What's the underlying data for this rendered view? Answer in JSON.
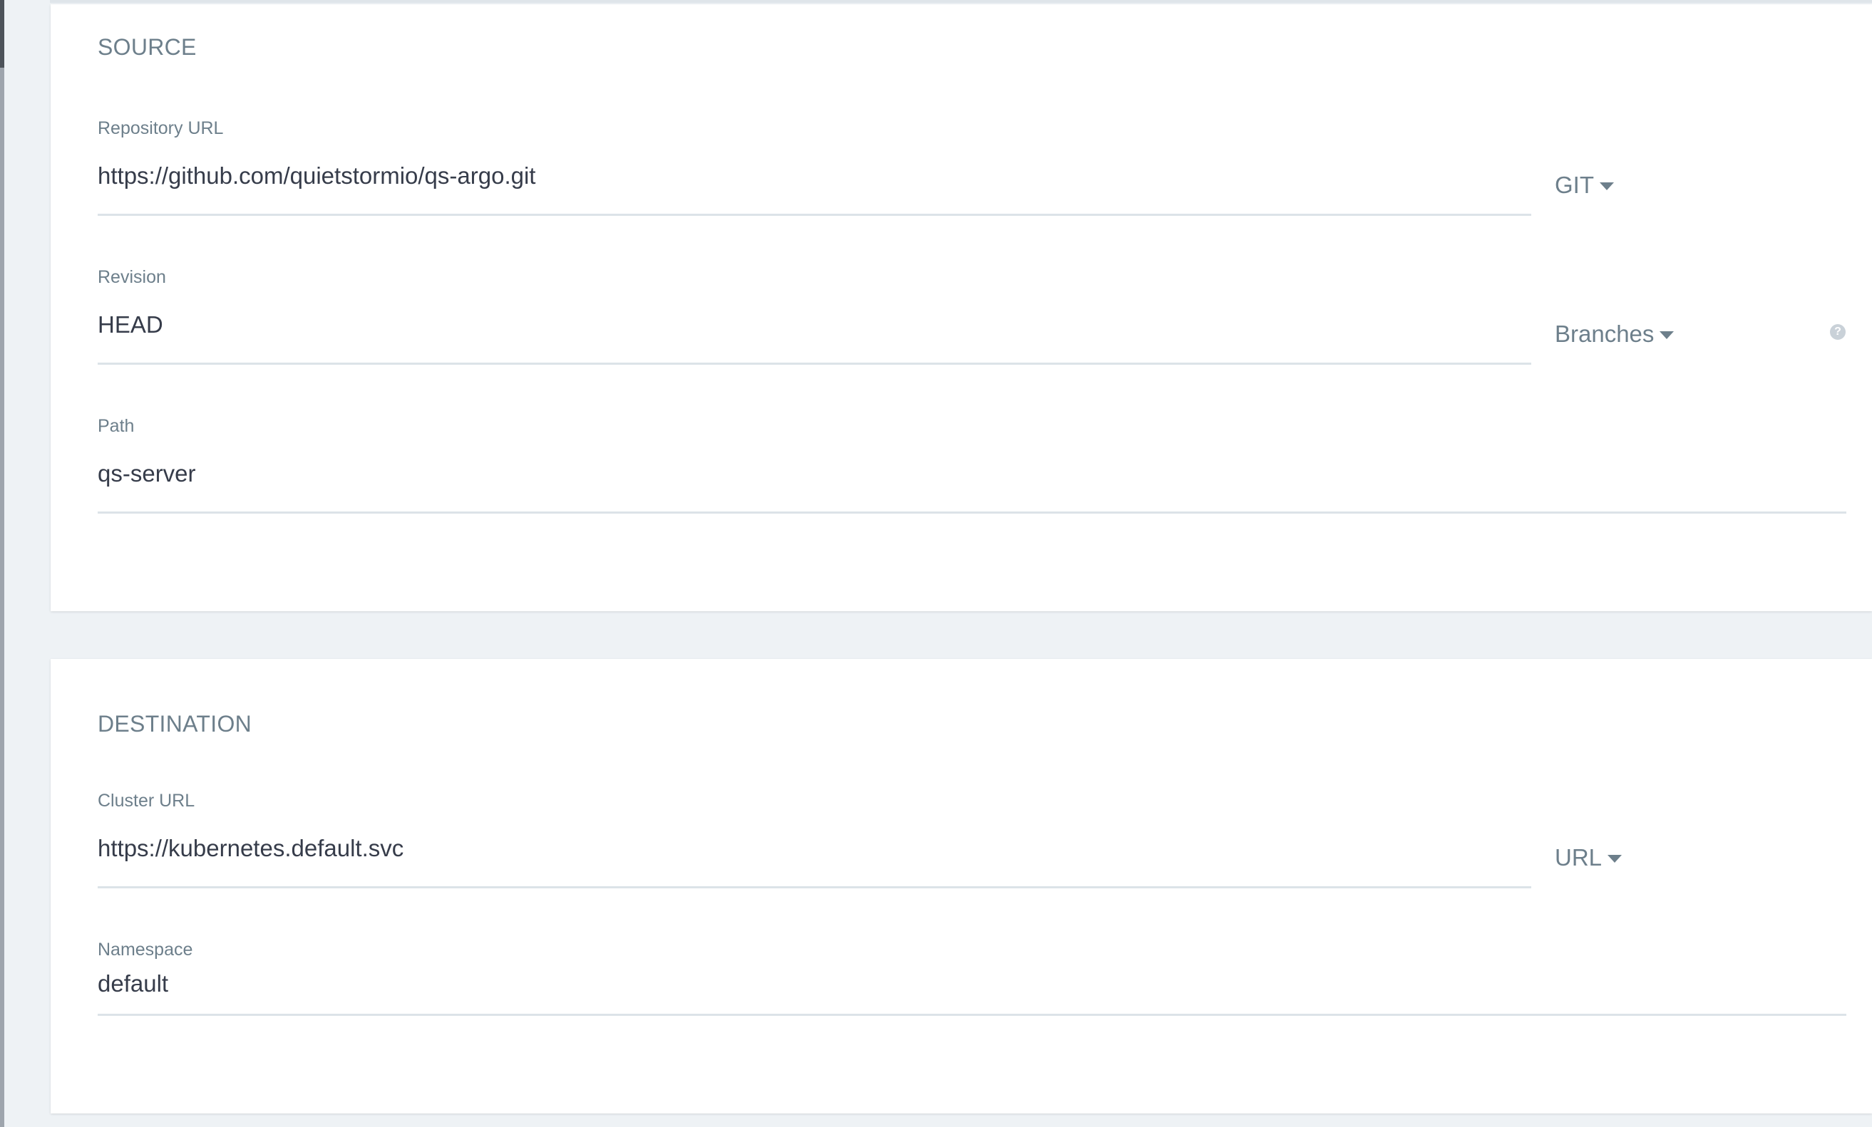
{
  "source": {
    "title": "SOURCE",
    "repository": {
      "label": "Repository URL",
      "value": "https://github.com/quietstormio/qs-argo.git",
      "type_dropdown": "GIT"
    },
    "revision": {
      "label": "Revision",
      "value": "HEAD",
      "type_dropdown": "Branches",
      "help_icon": "?"
    },
    "path": {
      "label": "Path",
      "value": "qs-server"
    }
  },
  "destination": {
    "title": "DESTINATION",
    "cluster": {
      "label": "Cluster URL",
      "value": "https://kubernetes.default.svc",
      "type_dropdown": "URL"
    },
    "namespace": {
      "label": "Namespace",
      "value": "default"
    }
  },
  "colors": {
    "background": "#eef2f5",
    "label": "#6d7f8b",
    "value": "#363c4a",
    "underline": "#dce3e8"
  }
}
